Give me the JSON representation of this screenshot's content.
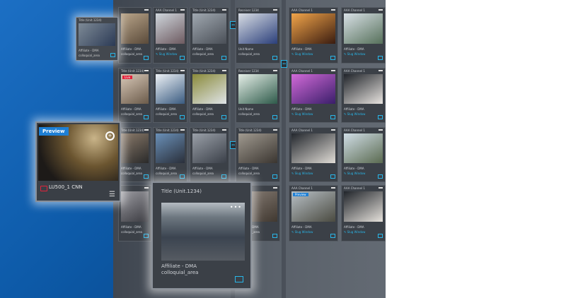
{
  "overlay_small": {
    "title": "Title (Unit.1234)",
    "line1": "Affiliate - DMA",
    "line2": "colloquial_area"
  },
  "preview_panel": {
    "badge": "Preview",
    "channel": "LU500_1 CNN",
    "accent": "#e2233b"
  },
  "overlay_large": {
    "title": "Title (Unit.1234)",
    "line1": "Affiliate - DMA",
    "line2": "colloquial_area"
  },
  "colors": {
    "accent": "#29b6e8",
    "live": "#e2233b",
    "preview": "#1e7fd4"
  },
  "tiles": [
    {
      "title": "",
      "line1": "Affiliate - DMA",
      "line2": "colloquial_area",
      "thumb": [
        "#b9a58a",
        "#5a4a3a"
      ]
    },
    {
      "title": "AAA Channel 1",
      "line1": "Affiliate - DMA",
      "line2": "Slug Window",
      "slug": true,
      "thumb": [
        "#cfd6dc",
        "#6d5a60"
      ]
    },
    {
      "title": "Title (Unit.1234)",
      "line1": "Affiliate - DMA",
      "line2": "colloquial_area",
      "thumb": [
        "#a0a8b0",
        "#4a4f57"
      ]
    },
    {
      "title": "Receiver 1234",
      "line1": "Unit Name",
      "line2": "colloquial_area",
      "thumb": [
        "#d8dde4",
        "#2b3f7a"
      ]
    },
    {
      "title": "AAA Channel 1",
      "line1": "Affiliate - DMA",
      "line2": "Slug Window",
      "slug": true,
      "thumb": [
        "#f2a54a",
        "#3a1c10"
      ]
    },
    {
      "title": "AAA Channel 1",
      "line1": "Affiliate - DMA",
      "line2": "Slug Window",
      "slug": true,
      "thumb": [
        "#d8e0e6",
        "#56705a"
      ]
    },
    {
      "title": "Title (Unit.1234)",
      "line1": "Affiliate - DMA",
      "line2": "colloquial_area",
      "live": "Live",
      "thumb": [
        "#d8c8b8",
        "#6b5b4a"
      ]
    },
    {
      "title": "Title (Unit.1234)",
      "line1": "Affiliate - DMA",
      "line2": "colloquial_area",
      "thumb": [
        "#eef2f6",
        "#3a5b80"
      ]
    },
    {
      "title": "Title (Unit.1234)",
      "line1": "Affiliate - DMA",
      "line2": "colloquial_area",
      "thumb": [
        "#8a8a3a",
        "#dfe4e8"
      ]
    },
    {
      "title": "Receiver 1234",
      "line1": "Unit Name",
      "line2": "colloquial_area",
      "thumb": [
        "#e6efe8",
        "#2e5a4a"
      ]
    },
    {
      "title": "AAA Channel 1",
      "line1": "Affiliate - DMA",
      "line2": "Slug Window",
      "slug": true,
      "thumb": [
        "#d26ad8",
        "#3a1e6a"
      ]
    },
    {
      "title": "AAA Channel 1",
      "line1": "Affiliate - DMA",
      "line2": "Slug Window",
      "slug": true,
      "thumb": [
        "#20242a",
        "#e8e4e0"
      ]
    },
    {
      "title": "Title (Unit.1234)",
      "line1": "Affiliate - DMA",
      "line2": "colloquial_area",
      "thumb": [
        "#8a7a6a",
        "#2a2a2a"
      ]
    },
    {
      "title": "Title (Unit.1234)",
      "line1": "Affiliate - DMA",
      "line2": "colloquial_area",
      "thumb": [
        "#6a90b8",
        "#2a2f3a"
      ]
    },
    {
      "title": "Title (Unit.1234)",
      "line1": "Affiliate - DMA",
      "line2": "colloquial_area",
      "thumb": [
        "#9aa0a8",
        "#3a3f48"
      ]
    },
    {
      "title": "Title (Unit.1234)",
      "line1": "Affiliate - DMA",
      "line2": "colloquial_area",
      "thumb": [
        "#a09a90",
        "#3a3530"
      ]
    },
    {
      "title": "AAA Channel 1",
      "line1": "Affiliate - DMA",
      "line2": "Slug Window",
      "slug": true,
      "thumb": [
        "#23272d",
        "#e0dcd6"
      ]
    },
    {
      "title": "AAA Channel 1",
      "line1": "Affiliate - DMA",
      "line2": "Slug Window",
      "slug": true,
      "thumb": [
        "#d0dde6",
        "#5a6a50"
      ]
    },
    {
      "title": "",
      "line1": "Affiliate - DMA",
      "line2": "colloquial_area",
      "thumb": [
        "#9a9aa0",
        "#3a3a40"
      ]
    },
    {
      "title": "",
      "line1": "Affiliate - DMA",
      "line2": "colloquial_area",
      "thumb": [
        "#8a8078",
        "#403830"
      ]
    },
    {
      "title": "AAA Channel 1",
      "line1": "Affiliate - DMA",
      "line2": "Slug Window",
      "slug": true,
      "preview": "Preview",
      "thumb": [
        "#b8c0c6",
        "#4a4a40"
      ]
    },
    {
      "title": "AAA Channel 1",
      "line1": "Affiliate - DMA",
      "line2": "Slug Window",
      "slug": true,
      "thumb": [
        "#20242a",
        "#e6e2dc"
      ]
    }
  ]
}
